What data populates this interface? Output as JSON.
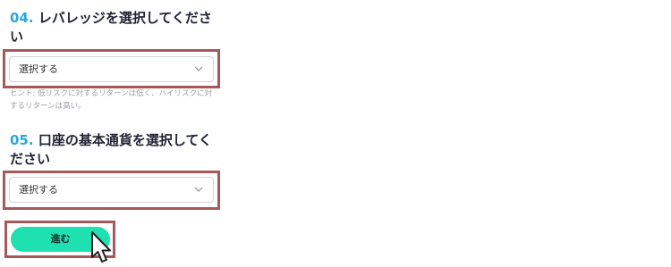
{
  "q4": {
    "number": "04.",
    "title": "レバレッジを選択してください",
    "select_value": "選択する",
    "hint": "ヒント: 低リスクに対するリターンは低く、ハイリスクに対するリターンは高い。"
  },
  "q5": {
    "number": "05.",
    "title": "口座の基本通貨を選択してください",
    "select_value": "選択する"
  },
  "next_button": {
    "label": "進む"
  },
  "colors": {
    "accent_number": "#29a8e0",
    "button": "#1ee0b0",
    "highlight_border": "#a85858"
  },
  "icons": [
    "chevron-down-icon",
    "mouse-pointer-icon"
  ]
}
